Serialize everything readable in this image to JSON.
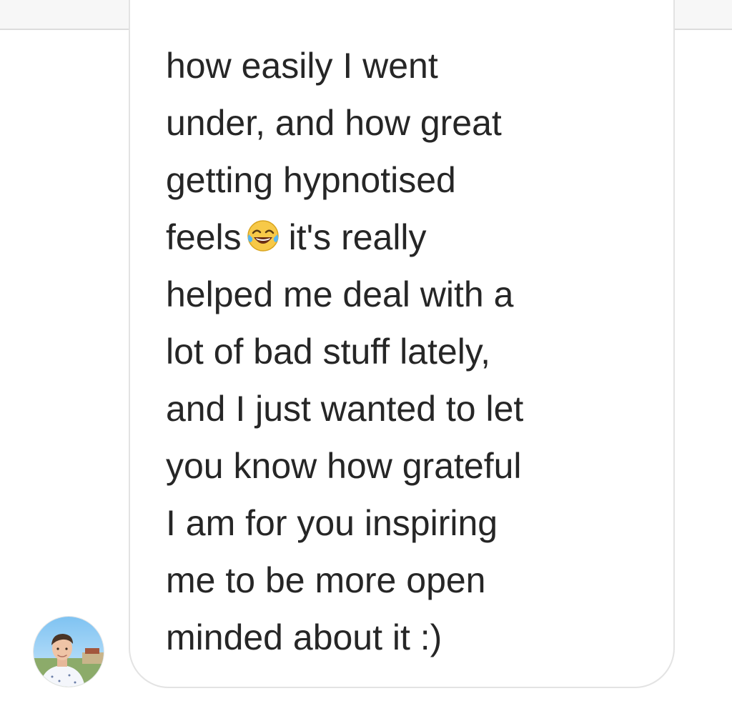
{
  "thread": {
    "message": {
      "lines": [
        "how easily I went",
        "under, and how great",
        "getting hypnotised",
        {
          "before": "feels",
          "emoji": "face-with-tears-of-joy",
          "after": "it's really"
        },
        "helped me deal with a",
        "lot of bad stuff lately,",
        "and I just wanted to let",
        "you know how grateful",
        "I am for you inspiring",
        "me to be more open",
        "minded about it :)"
      ]
    },
    "sender": {
      "avatar": "profile-photo"
    }
  },
  "colors": {
    "text": "#262626",
    "bubble_border": "#e3e3e3",
    "header_bg": "#f7f7f7",
    "header_border": "#dcdcdc"
  }
}
